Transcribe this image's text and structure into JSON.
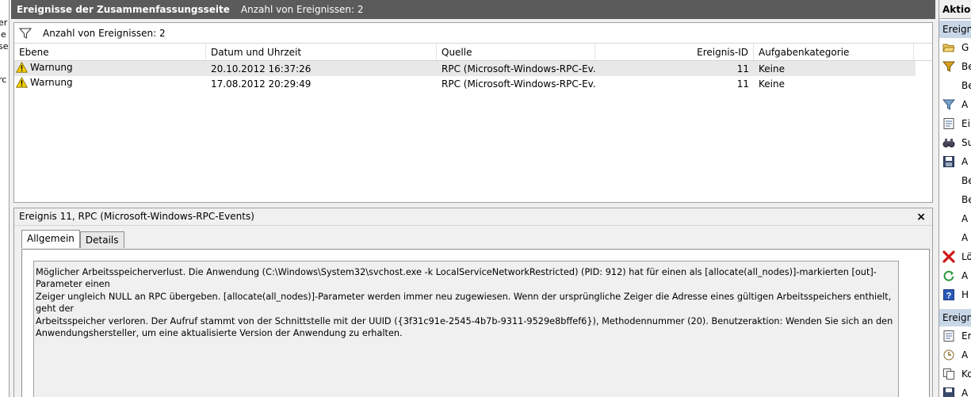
{
  "left_strip": [
    "er",
    "le",
    "se",
    "rc"
  ],
  "header": {
    "title": "Ereignisse der Zusammenfassungsseite",
    "count_text": "Anzahl von Ereignissen: 2"
  },
  "filter": {
    "label": "Anzahl von Ereignissen: 2"
  },
  "grid": {
    "columns": [
      "Ebene",
      "Datum und Uhrzeit",
      "Quelle",
      "Ereignis-ID",
      "Aufgabenkategorie"
    ],
    "rows": [
      {
        "level": "Warnung",
        "datetime": "20.10.2012 16:37:26",
        "source": "RPC (Microsoft-Windows-RPC-Ev...",
        "id": "11",
        "category": "Keine"
      },
      {
        "level": "Warnung",
        "datetime": "17.08.2012 20:29:49",
        "source": "RPC (Microsoft-Windows-RPC-Ev...",
        "id": "11",
        "category": "Keine"
      }
    ]
  },
  "detail": {
    "title": "Ereignis 11, RPC (Microsoft-Windows-RPC-Events)",
    "close": "×",
    "tabs": [
      "Allgemein",
      "Details"
    ],
    "message_lines": [
      "Möglicher Arbeitsspeicherverlust.  Die Anwendung (C:\\Windows\\System32\\svchost.exe -k LocalServiceNetworkRestricted) (PID: 912) hat für einen als [allocate(all_nodes)]-markierten [out]-Parameter einen",
      "Zeiger ungleich NULL an RPC übergeben. [allocate(all_nodes)]-Parameter werden immer neu zugewiesen. Wenn der ursprüngliche Zeiger die Adresse eines gültigen Arbeitsspeichers enthielt, geht der",
      "Arbeitsspeicher verloren. Der Aufruf stammt von der Schnittstelle mit der UUID ({3f31c91e-2545-4b7b-9311-9529e8bffef6}), Methodennummer (20).  Benutzeraktion: Wenden Sie sich an den",
      "Anwendungshersteller, um eine aktualisierte Version der Anwendung zu erhalten."
    ]
  },
  "actions": {
    "header": "Aktion",
    "section1": "Ereign",
    "items1": [
      {
        "icon": "folder-open-icon",
        "label": "G"
      },
      {
        "icon": "filter-icon",
        "label": "Be"
      },
      {
        "icon": "",
        "label": "Be"
      },
      {
        "icon": "filter-icon",
        "label": "A"
      },
      {
        "icon": "properties-icon",
        "label": "Ei"
      },
      {
        "icon": "binoculars-icon",
        "label": "Su"
      },
      {
        "icon": "save-icon",
        "label": "A"
      },
      {
        "icon": "",
        "label": "Be"
      },
      {
        "icon": "",
        "label": "Be"
      },
      {
        "icon": "",
        "label": "A"
      },
      {
        "icon": "",
        "label": "A"
      },
      {
        "icon": "delete-icon",
        "label": "Lö"
      },
      {
        "icon": "refresh-icon",
        "label": "A"
      },
      {
        "icon": "help-icon",
        "label": "H"
      }
    ],
    "section2": "Ereign",
    "items2": [
      {
        "icon": "properties-icon",
        "label": "Er"
      },
      {
        "icon": "attach-task-icon",
        "label": "A"
      },
      {
        "icon": "copy-icon",
        "label": "Ko"
      },
      {
        "icon": "save-icon",
        "label": "A"
      }
    ]
  }
}
